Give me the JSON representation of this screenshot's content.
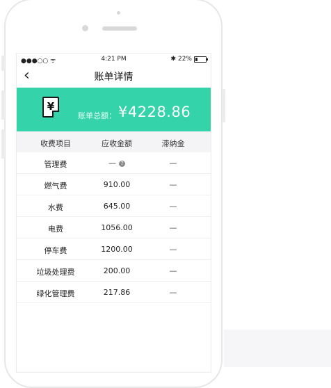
{
  "status_bar": {
    "signal": "●●●○○ ᯤ",
    "time": "4:21 PM",
    "bluetooth": "✱",
    "battery": "22%",
    "battery_level": 0.22
  },
  "nav": {
    "back_icon": "chevron-left-icon",
    "title": "账单详情"
  },
  "summary": {
    "icon": "receipt-yen-icon",
    "doc_symbol": "¥",
    "label": "账单总额：",
    "amount": "¥4228.86"
  },
  "table": {
    "headers": [
      "收费项目",
      "应收金额",
      "滞纳金"
    ],
    "rows": [
      {
        "item": "管理费",
        "amount": "—",
        "late_fee": "—",
        "info": "?"
      },
      {
        "item": "燃气费",
        "amount": "910.00",
        "late_fee": "—"
      },
      {
        "item": "水费",
        "amount": "645.00",
        "late_fee": "—"
      },
      {
        "item": "电费",
        "amount": "1056.00",
        "late_fee": "—"
      },
      {
        "item": "停车费",
        "amount": "1200.00",
        "late_fee": "—"
      },
      {
        "item": "垃圾处理费",
        "amount": "200.00",
        "late_fee": "—"
      },
      {
        "item": "绿化管理费",
        "amount": "217.86",
        "late_fee": "—"
      }
    ]
  },
  "colors": {
    "accent": "#34d3a9",
    "header_bg": "#f4f4f6"
  }
}
